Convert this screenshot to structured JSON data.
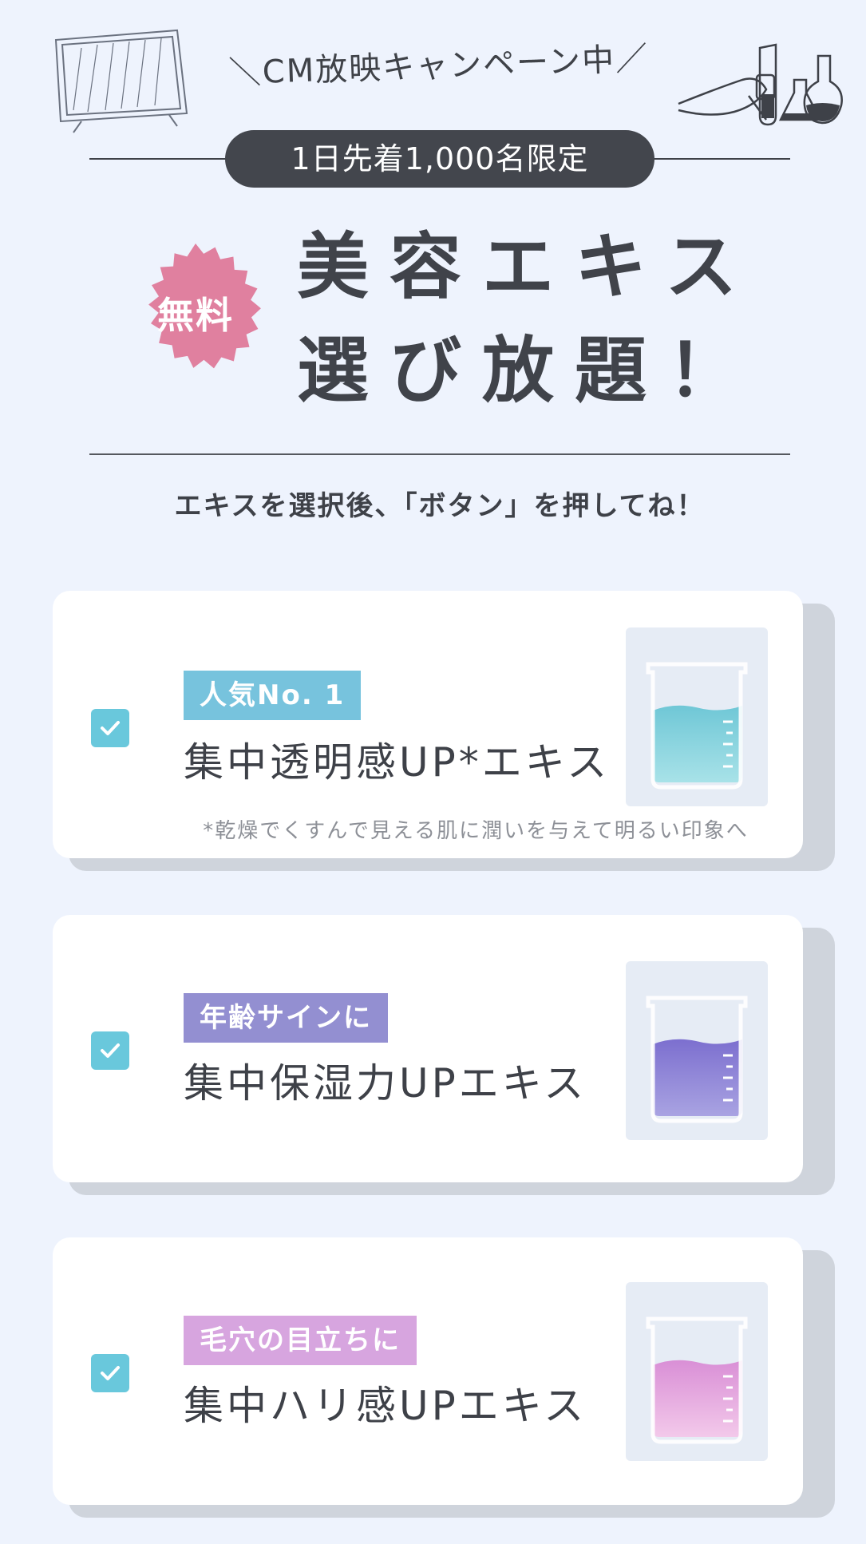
{
  "header": {
    "campaign": "＼CM放映キャンペーン中／",
    "limit": "1日先着1,000名限定",
    "badge": "無料",
    "headline_line1": "美容エキス",
    "headline_line2": "選び放題！",
    "instruction": "エキスを選択後、「ボタン」を押してね！"
  },
  "cards": [
    {
      "tag": "人気No. 1",
      "tag_color": "#77c3dd",
      "name": "集中透明感UP*エキス",
      "note": "*乾燥でくすんで見える肌に潤いを与えて明るい印象へ",
      "checked": true,
      "liquid_color": "#7dd0de",
      "icon": "beaker-icon"
    },
    {
      "tag": "年齢サインに",
      "tag_color": "#938fd1",
      "name": "集中保湿力UPエキス",
      "checked": true,
      "liquid_color": "#8b7fd3",
      "icon": "beaker-icon"
    },
    {
      "tag": "毛穴の目立ちに",
      "tag_color": "#d7a5df",
      "name": "集中ハリ感UPエキス",
      "checked": true,
      "liquid_color": "#e2a2dc",
      "icon": "beaker-icon"
    }
  ],
  "colors": {
    "background": "#eef3fd",
    "pill": "#43464d",
    "badge": "#e0809f",
    "checkbox": "#69c8dc"
  }
}
